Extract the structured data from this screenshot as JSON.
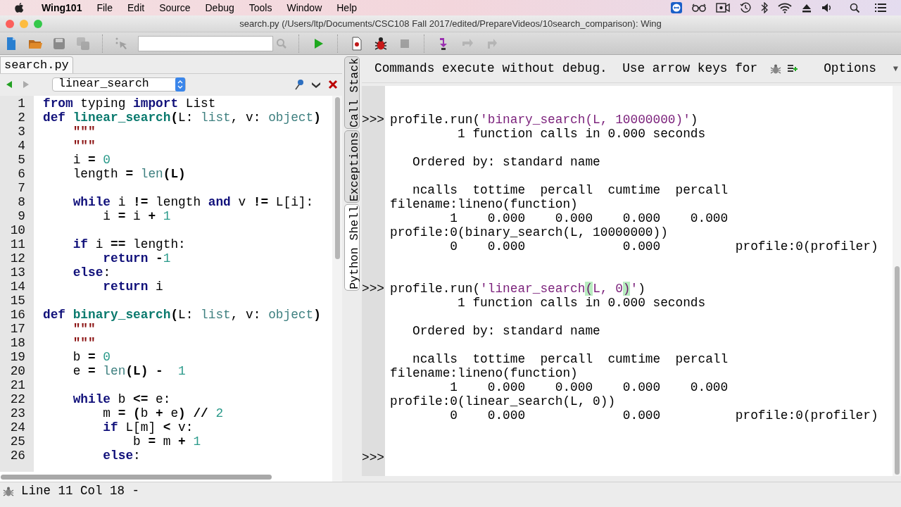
{
  "menu_bar": {
    "app": "Wing101",
    "items": [
      "File",
      "Edit",
      "Source",
      "Debug",
      "Tools",
      "Window",
      "Help"
    ]
  },
  "window": {
    "title": "search.py (/Users/ltp/Documents/CSC108 Fall 2017/edited/PrepareVideos/10search_comparison): Wing"
  },
  "toolbar": [
    {
      "kind": "new-file",
      "disabled": false
    },
    {
      "kind": "open",
      "disabled": false
    },
    {
      "kind": "save",
      "disabled": false
    },
    {
      "kind": "save-all",
      "disabled": true
    },
    {
      "kind": "sep"
    },
    {
      "kind": "pointer",
      "disabled": true
    },
    {
      "kind": "search"
    },
    {
      "kind": "sep"
    },
    {
      "kind": "run",
      "disabled": false
    },
    {
      "kind": "sep"
    },
    {
      "kind": "breakpoint",
      "disabled": false
    },
    {
      "kind": "debug",
      "disabled": false
    },
    {
      "kind": "stop",
      "disabled": true
    },
    {
      "kind": "sep"
    },
    {
      "kind": "step-into",
      "disabled": false
    },
    {
      "kind": "step-over",
      "disabled": true
    },
    {
      "kind": "step-out",
      "disabled": true
    }
  ],
  "editor": {
    "tab": "search.py",
    "back_disabled": false,
    "forward_disabled": true,
    "scope": "linear_search",
    "lines": [
      {
        "number": "1",
        "tokens": [
          {
            "kind": "kw",
            "text": "from"
          },
          {
            "kind": "plain",
            "text": " typing "
          },
          {
            "kind": "kw",
            "text": "import"
          },
          {
            "kind": "plain",
            "text": " List"
          }
        ]
      },
      {
        "number": "2",
        "tokens": [
          {
            "kind": "kw",
            "text": "def "
          },
          {
            "kind": "fn",
            "text": "linear_search"
          },
          {
            "kind": "op",
            "text": "("
          },
          {
            "kind": "plain",
            "text": "L: "
          },
          {
            "kind": "builtin",
            "text": "list"
          },
          {
            "kind": "plain",
            "text": ", v: "
          },
          {
            "kind": "builtin",
            "text": "object"
          },
          {
            "kind": "op",
            "text": ")"
          }
        ]
      },
      {
        "number": "3",
        "tokens": [
          {
            "kind": "str",
            "text": "    \"\"\""
          }
        ]
      },
      {
        "number": "4",
        "tokens": [
          {
            "kind": "str",
            "text": "    \"\"\""
          }
        ]
      },
      {
        "number": "5",
        "tokens": [
          {
            "kind": "plain",
            "text": "    i "
          },
          {
            "kind": "op",
            "text": "="
          },
          {
            "kind": "num",
            "text": " 0"
          }
        ]
      },
      {
        "number": "6",
        "tokens": [
          {
            "kind": "plain",
            "text": "    length "
          },
          {
            "kind": "op",
            "text": "="
          },
          {
            "kind": "builtin",
            "text": " len"
          },
          {
            "kind": "op",
            "text": "(L)"
          }
        ]
      },
      {
        "number": "7"
      },
      {
        "number": "8",
        "tokens": [
          {
            "kind": "kw",
            "text": "    while"
          },
          {
            "kind": "plain",
            "text": " i "
          },
          {
            "kind": "op",
            "text": "!="
          },
          {
            "kind": "plain",
            "text": " length "
          },
          {
            "kind": "kw",
            "text": "and"
          },
          {
            "kind": "plain",
            "text": " v "
          },
          {
            "kind": "op",
            "text": "!="
          },
          {
            "kind": "plain",
            "text": " L[i]:"
          }
        ]
      },
      {
        "number": "9",
        "tokens": [
          {
            "kind": "plain",
            "text": "        i "
          },
          {
            "kind": "op",
            "text": "="
          },
          {
            "kind": "plain",
            "text": " i "
          },
          {
            "kind": "op",
            "text": "+"
          },
          {
            "kind": "num",
            "text": " 1"
          }
        ]
      },
      {
        "number": "10"
      },
      {
        "number": "11",
        "tokens": [
          {
            "kind": "kw",
            "text": "    if"
          },
          {
            "kind": "plain",
            "text": " i "
          },
          {
            "kind": "op",
            "text": "=="
          },
          {
            "kind": "plain",
            "text": " length:"
          }
        ]
      },
      {
        "number": "12",
        "tokens": [
          {
            "kind": "kw",
            "text": "        return"
          },
          {
            "kind": "op",
            "text": " -"
          },
          {
            "kind": "num",
            "text": "1"
          }
        ]
      },
      {
        "number": "13",
        "tokens": [
          {
            "kind": "kw",
            "text": "    else"
          },
          {
            "kind": "plain",
            "text": ":"
          }
        ]
      },
      {
        "number": "14",
        "tokens": [
          {
            "kind": "kw",
            "text": "        return"
          },
          {
            "kind": "plain",
            "text": " i"
          }
        ]
      },
      {
        "number": "15"
      },
      {
        "number": "16",
        "tokens": [
          {
            "kind": "kw",
            "text": "def "
          },
          {
            "kind": "fn",
            "text": "binary_search"
          },
          {
            "kind": "op",
            "text": "("
          },
          {
            "kind": "plain",
            "text": "L: "
          },
          {
            "kind": "builtin",
            "text": "list"
          },
          {
            "kind": "plain",
            "text": ", v: "
          },
          {
            "kind": "builtin",
            "text": "object"
          },
          {
            "kind": "op",
            "text": ")"
          }
        ]
      },
      {
        "number": "17",
        "tokens": [
          {
            "kind": "str",
            "text": "    \"\"\""
          }
        ]
      },
      {
        "number": "18",
        "tokens": [
          {
            "kind": "str",
            "text": "    \"\"\""
          }
        ]
      },
      {
        "number": "19",
        "tokens": [
          {
            "kind": "plain",
            "text": "    b "
          },
          {
            "kind": "op",
            "text": "="
          },
          {
            "kind": "num",
            "text": " 0"
          }
        ]
      },
      {
        "number": "20",
        "tokens": [
          {
            "kind": "plain",
            "text": "    e "
          },
          {
            "kind": "op",
            "text": "="
          },
          {
            "kind": "builtin",
            "text": " len"
          },
          {
            "kind": "op",
            "text": "(L) -"
          },
          {
            "kind": "num",
            "text": "  1"
          }
        ]
      },
      {
        "number": "21"
      },
      {
        "number": "22",
        "tokens": [
          {
            "kind": "kw",
            "text": "    while"
          },
          {
            "kind": "plain",
            "text": " b "
          },
          {
            "kind": "op",
            "text": "<="
          },
          {
            "kind": "plain",
            "text": " e:"
          }
        ]
      },
      {
        "number": "23",
        "tokens": [
          {
            "kind": "plain",
            "text": "        m "
          },
          {
            "kind": "op",
            "text": "= ("
          },
          {
            "kind": "plain",
            "text": "b "
          },
          {
            "kind": "op",
            "text": "+"
          },
          {
            "kind": "plain",
            "text": " e"
          },
          {
            "kind": "op",
            "text": ") //"
          },
          {
            "kind": "num",
            "text": " 2"
          }
        ]
      },
      {
        "number": "24",
        "tokens": [
          {
            "kind": "kw",
            "text": "        if"
          },
          {
            "kind": "plain",
            "text": " L[m] "
          },
          {
            "kind": "op",
            "text": "<"
          },
          {
            "kind": "plain",
            "text": " v:"
          }
        ]
      },
      {
        "number": "25",
        "tokens": [
          {
            "kind": "plain",
            "text": "            b "
          },
          {
            "kind": "op",
            "text": "="
          },
          {
            "kind": "plain",
            "text": " m "
          },
          {
            "kind": "op",
            "text": "+"
          },
          {
            "kind": "num",
            "text": " 1"
          }
        ]
      },
      {
        "number": "26",
        "tokens": [
          {
            "kind": "kw",
            "text": "        else"
          },
          {
            "kind": "plain",
            "text": ":"
          }
        ]
      }
    ]
  },
  "side_tabs": [
    {
      "label": "Call Stack",
      "selected": false
    },
    {
      "label": "Exceptions",
      "selected": false
    },
    {
      "label": "Python Shell",
      "selected": true
    }
  ],
  "shell": {
    "header": "Commands execute without debug.  Use arrow keys for",
    "options": "Options",
    "menu_arrow": "▼",
    "lines": [
      {
        "prompt": ">>>",
        "tokens": [
          {
            "kind": "plain",
            "text": "profile.run"
          },
          {
            "kind": "op",
            "text": "("
          },
          {
            "kind": "str",
            "text": "'binary_search(L, 10000000)'"
          },
          {
            "kind": "op",
            "text": ")"
          }
        ]
      },
      {
        "tokens": [
          {
            "kind": "plain",
            "text": "         1 function calls in 0.000 seconds"
          }
        ]
      },
      {
        "kind": "blank"
      },
      {
        "tokens": [
          {
            "kind": "plain",
            "text": "   Ordered by: standard name"
          }
        ]
      },
      {
        "kind": "blank"
      },
      {
        "tokens": [
          {
            "kind": "plain",
            "text": "   ncalls  tottime  percall  cumtime  percall"
          }
        ]
      },
      {
        "tokens": [
          {
            "kind": "plain",
            "text": "filename:lineno(function)"
          }
        ]
      },
      {
        "tokens": [
          {
            "kind": "plain",
            "text": "        1    0.000    0.000    0.000    0.000"
          }
        ]
      },
      {
        "tokens": [
          {
            "kind": "plain",
            "text": "profile:0(binary_search(L, 10000000))"
          }
        ]
      },
      {
        "tokens": [
          {
            "kind": "plain",
            "text": "        0    0.000             0.000          profile:0(profiler)"
          }
        ]
      },
      {
        "kind": "blank"
      },
      {
        "kind": "blank"
      },
      {
        "prompt": ">>>",
        "tokens": [
          {
            "kind": "plain",
            "text": "profile.run"
          },
          {
            "kind": "op",
            "text": "("
          },
          {
            "kind": "str",
            "text": "'linear_search"
          },
          {
            "kind": "match",
            "text": "("
          },
          {
            "kind": "str",
            "text": "L, 0"
          },
          {
            "kind": "match",
            "text": ")"
          },
          {
            "kind": "str",
            "text": "'"
          },
          {
            "kind": "op",
            "text": ")"
          }
        ]
      },
      {
        "tokens": [
          {
            "kind": "plain",
            "text": "         1 function calls in 0.000 seconds"
          }
        ]
      },
      {
        "kind": "blank"
      },
      {
        "tokens": [
          {
            "kind": "plain",
            "text": "   Ordered by: standard name"
          }
        ]
      },
      {
        "kind": "blank"
      },
      {
        "tokens": [
          {
            "kind": "plain",
            "text": "   ncalls  tottime  percall  cumtime  percall"
          }
        ]
      },
      {
        "tokens": [
          {
            "kind": "plain",
            "text": "filename:lineno(function)"
          }
        ]
      },
      {
        "tokens": [
          {
            "kind": "plain",
            "text": "        1    0.000    0.000    0.000    0.000"
          }
        ]
      },
      {
        "tokens": [
          {
            "kind": "plain",
            "text": "profile:0(linear_search(L, 0))"
          }
        ]
      },
      {
        "tokens": [
          {
            "kind": "plain",
            "text": "        0    0.000             0.000          profile:0(profiler)"
          }
        ]
      },
      {
        "kind": "blank"
      },
      {
        "kind": "blank"
      },
      {
        "prompt": ">>>"
      }
    ]
  },
  "status_bar": {
    "text": "Line 11 Col 18 -"
  }
}
